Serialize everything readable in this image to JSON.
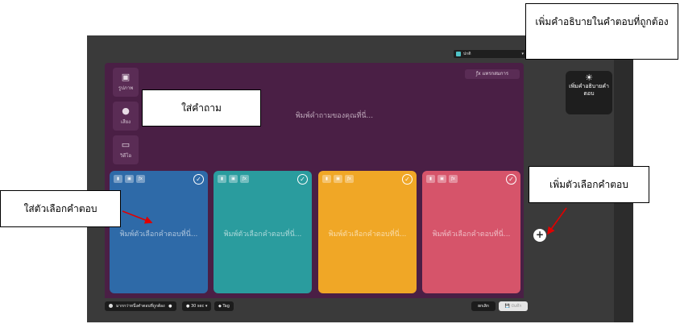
{
  "topbar": {
    "select_label": "ปกติ",
    "select_caret": "▾"
  },
  "question": {
    "media_buttons": [
      {
        "icon": "image-icon",
        "glyph": "▣",
        "label": "รูปภาพ"
      },
      {
        "icon": "microphone-icon",
        "glyph": "●",
        "label": "เสียง"
      },
      {
        "icon": "video-icon",
        "glyph": "▭",
        "label": "วิดีโอ"
      }
    ],
    "formula_button": "ƒx แทรกสมการ",
    "placeholder": "พิมพ์คำถามของคุณที่นี่..."
  },
  "answers": [
    {
      "color": "#2e6aa8",
      "placeholder": "พิมพ์ตัวเลือกคำตอบที่นี่..."
    },
    {
      "color": "#2a9c9e",
      "placeholder": "พิมพ์ตัวเลือกคำตอบที่นี่..."
    },
    {
      "color": "#f0a726",
      "placeholder": "พิมพ์ตัวเลือกคำตอบที่นี่..."
    },
    {
      "color": "#d6546a",
      "placeholder": "พิมพ์ตัวเลือกคำตอบที่นี่..."
    }
  ],
  "answer_tools": [
    "▮",
    "▣",
    "ƒx"
  ],
  "check_glyph": "✓",
  "add_answer_glyph": "+",
  "right_panel": {
    "bulb": "☀",
    "label": "เพิ่มคำอธิบายคำตอบ"
  },
  "bottom": {
    "toggle_label": "มากกว่าหนึ่งคำตอบที่ถูกต้อง",
    "info_glyph": "●",
    "time_label": "● 30 sec ▾",
    "tag_label": "◆ Tag",
    "cancel_label": "ยกเลิก",
    "save_label": "💾 บันทึก"
  },
  "callouts": {
    "explanation": "เพิ่มคำอธิบายในคำตอบที่ถูกต้อง",
    "question": "ใส่คำถาม",
    "answer_option": "ใส่ตัวเลือกคำตอบ",
    "add_option": "เพิ่มตัวเลือกคำตอบ"
  }
}
